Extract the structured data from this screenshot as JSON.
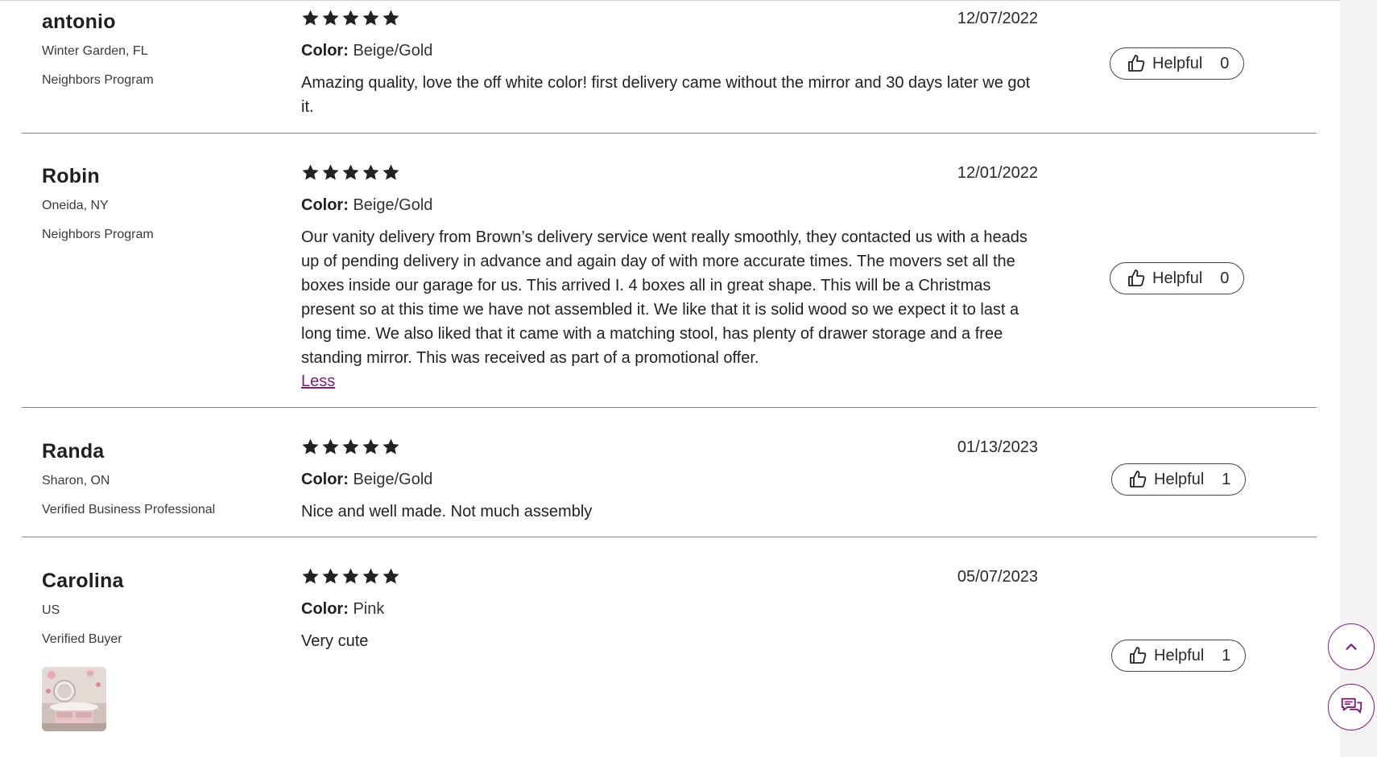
{
  "reviews": [
    {
      "name": "antonio",
      "location": "Winter Garden, FL",
      "badge": "Neighbors Program",
      "rating": 5,
      "date": "12/07/2022",
      "color_label": "Color",
      "color_value": "Beige/Gold",
      "text": "Amazing quality, love the off white color! first delivery came without the mirror and 30 days later we got it.",
      "helpful_label": "Helpful",
      "helpful_count": "0"
    },
    {
      "name": "Robin",
      "location": "Oneida, NY",
      "badge": "Neighbors Program",
      "rating": 5,
      "date": "12/01/2022",
      "color_label": "Color",
      "color_value": "Beige/Gold",
      "text": "Our vanity delivery from Brown’s delivery service went really smoothly, they contacted us with a heads up of pending delivery in advance and again day of with more accurate times. The movers set all the boxes inside our garage for us. This arrived I. 4 boxes all in great shape. This will be a Christmas present so at this time we have not assembled it. We like that it is solid wood so we expect it to last a long time. We also liked that it came with a matching stool, has plenty of drawer storage and a free standing mirror. This was received as part of a promotional offer.",
      "less_label": "Less",
      "helpful_label": "Helpful",
      "helpful_count": "0"
    },
    {
      "name": "Randa",
      "location": "Sharon, ON",
      "badge": "Verified Business Professional",
      "rating": 5,
      "date": "01/13/2023",
      "color_label": "Color",
      "color_value": "Beige/Gold",
      "text": "Nice and well made. Not much assembly",
      "helpful_label": "Helpful",
      "helpful_count": "1"
    },
    {
      "name": "Carolina",
      "location": "US",
      "badge": "Verified Buyer",
      "rating": 5,
      "date": "05/07/2023",
      "color_label": "Color",
      "color_value": "Pink",
      "text": "Very cute",
      "helpful_label": "Helpful",
      "helpful_count": "1"
    }
  ],
  "icons": {
    "star": "star-icon",
    "thumb": "thumbs-up-icon",
    "scroll_top": "chevron-up-icon",
    "chat": "chat-bubbles-icon"
  },
  "colors": {
    "accent": "#7b1e7a",
    "text": "#2a2a2a",
    "divider": "#8a8a8a"
  }
}
